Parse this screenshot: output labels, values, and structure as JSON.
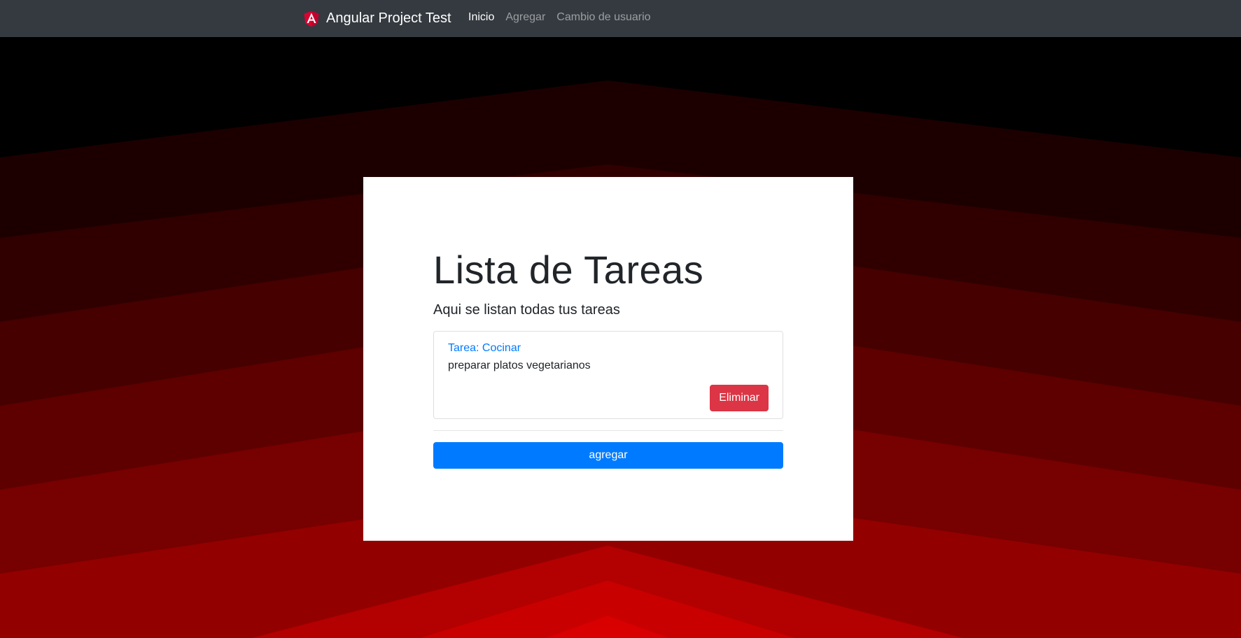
{
  "navbar": {
    "brand": "Angular Project Test",
    "links": [
      "Inicio",
      "Agregar",
      "Cambio de usuario"
    ]
  },
  "main": {
    "title": "Lista de Tareas",
    "subtitle": "Aqui se listan todas tus tareas",
    "tasks": [
      {
        "header": "Tarea: Cocinar",
        "description": "preparar platos vegetarianos",
        "delete_label": "Eliminar"
      }
    ],
    "add_label": "agregar"
  },
  "colors": {
    "navbar": "#343a40",
    "primary": "#007bff",
    "danger": "#dc3545",
    "angular_red": "#dd0031"
  }
}
